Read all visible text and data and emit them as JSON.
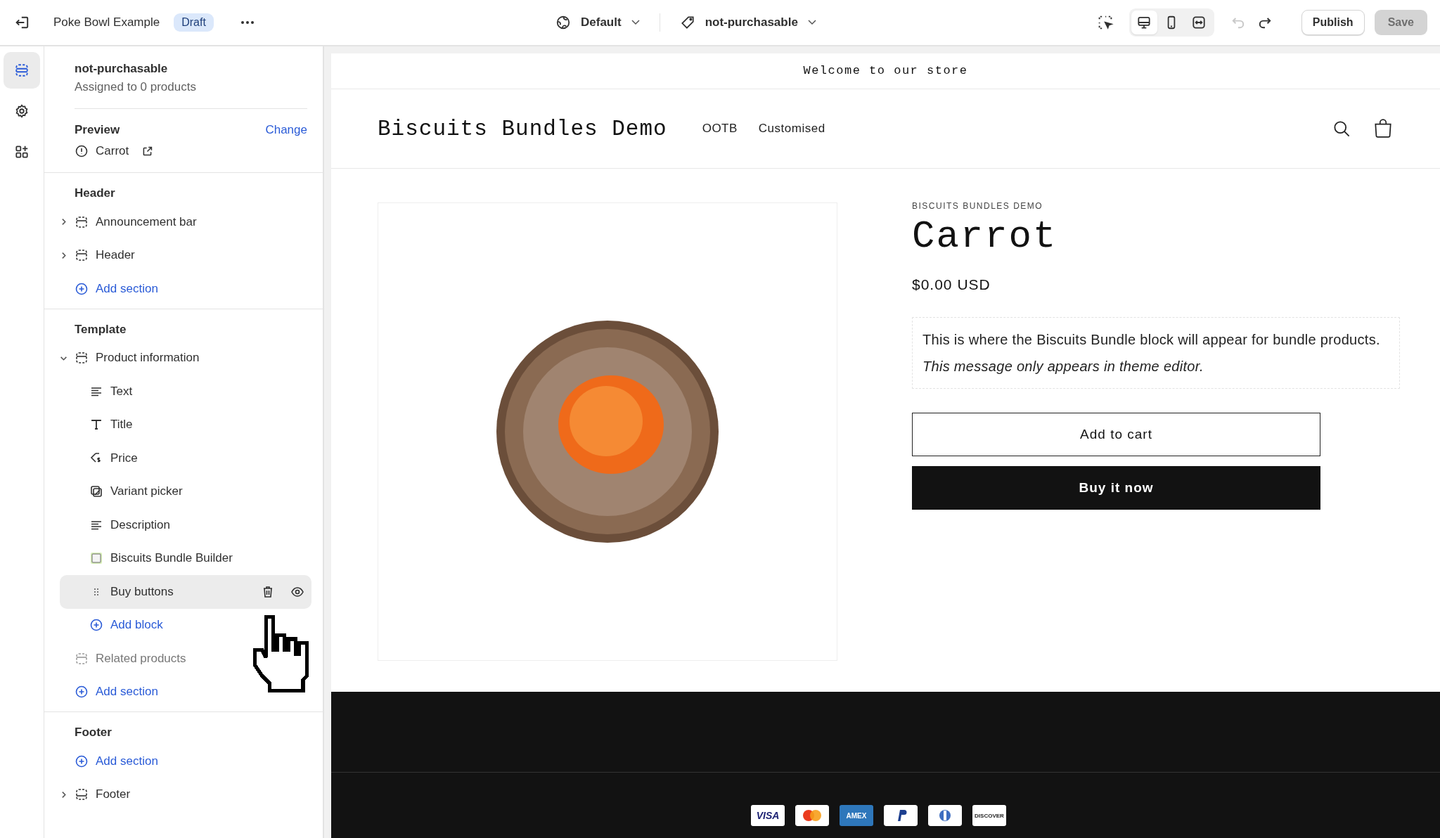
{
  "topbar": {
    "store_name": "Poke Bowl Example",
    "status_badge": "Draft",
    "theme_selector": "Default",
    "template_selector": "not-purchasable",
    "publish": "Publish",
    "save": {
      "label": "Save",
      "disabled": true
    },
    "undo_disabled": true,
    "view_modes": [
      {
        "kind": "desktop",
        "selected": true
      },
      {
        "kind": "mobile",
        "selected": false
      },
      {
        "kind": "fullwidth",
        "selected": false
      }
    ]
  },
  "rail": [
    {
      "kind": "sections",
      "selected": true
    },
    {
      "kind": "settings",
      "selected": false
    },
    {
      "kind": "apps",
      "selected": false
    }
  ],
  "sidebar": {
    "template_name": "not-purchasable",
    "assigned": "Assigned to 0 products",
    "preview": {
      "label": "Preview",
      "action": "Change",
      "product": "Carrot"
    },
    "groups": [
      {
        "title": "Header",
        "items": [
          {
            "kind": "section",
            "label": "Announcement bar",
            "expanded": false,
            "disabled": false
          },
          {
            "kind": "section",
            "label": "Header",
            "expanded": false,
            "disabled": false
          },
          {
            "kind": "add",
            "label": "Add section"
          }
        ]
      },
      {
        "title": "Template",
        "items": [
          {
            "kind": "section",
            "label": "Product information",
            "expanded": true,
            "disabled": false,
            "children": [
              {
                "kind": "text",
                "label": "Text",
                "hovered": false
              },
              {
                "kind": "title",
                "label": "Title",
                "hovered": false
              },
              {
                "kind": "price",
                "label": "Price",
                "hovered": false
              },
              {
                "kind": "variant",
                "label": "Variant picker",
                "hovered": false
              },
              {
                "kind": "text",
                "label": "Description",
                "hovered": false
              },
              {
                "kind": "app",
                "label": "Biscuits Bundle Builder",
                "hovered": false
              },
              {
                "kind": "drag",
                "label": "Buy buttons",
                "hovered": true
              },
              {
                "kind": "add",
                "label": "Add block",
                "hovered": false
              }
            ]
          },
          {
            "kind": "section",
            "label": "Related products",
            "expanded": false,
            "disabled": true
          },
          {
            "kind": "add",
            "label": "Add section"
          }
        ]
      },
      {
        "title": "Footer",
        "items": [
          {
            "kind": "add",
            "label": "Add section"
          },
          {
            "kind": "footer",
            "label": "Footer",
            "expanded": false,
            "disabled": false
          }
        ]
      }
    ]
  },
  "store": {
    "announcement": "Welcome to our store",
    "logo": "Biscuits Bundles Demo",
    "nav": [
      "OOTB",
      "Customised"
    ],
    "product": {
      "vendor": "BISCUITS BUNDLES DEMO",
      "title": "Carrot",
      "price": "$0.00 USD",
      "notice": "This is where the Biscuits Bundle block will appear for bundle products.",
      "notice_note": "This message only appears in theme editor.",
      "add_to_cart": "Add to cart",
      "buy_now": "Buy it now"
    },
    "payment_icons": [
      {
        "kind": "visa",
        "label": "VISA"
      },
      {
        "kind": "mastercard"
      },
      {
        "kind": "amex",
        "label": "AMEX"
      },
      {
        "kind": "paypal"
      },
      {
        "kind": "diners"
      },
      {
        "kind": "discover",
        "label": "DISCOVER"
      }
    ]
  }
}
